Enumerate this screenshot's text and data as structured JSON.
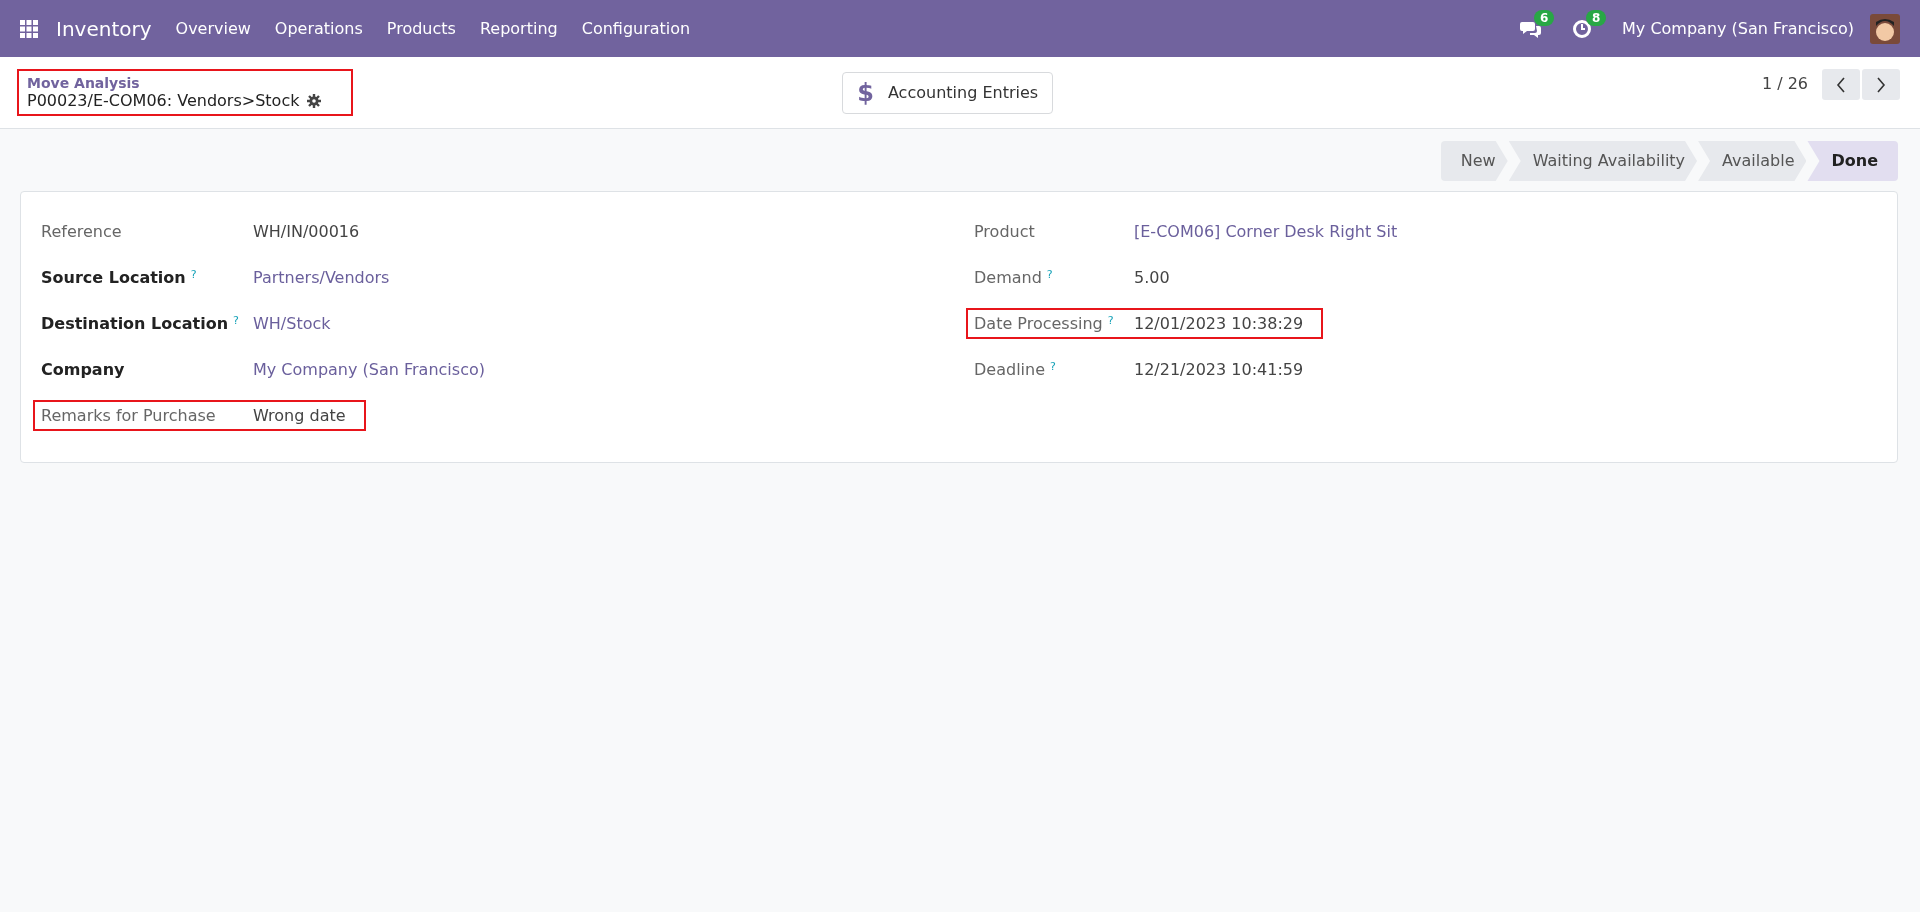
{
  "navbar": {
    "app_name": "Inventory",
    "menu": [
      "Overview",
      "Operations",
      "Products",
      "Reporting",
      "Configuration"
    ],
    "messages_count": "6",
    "activities_count": "8",
    "company": "My Company (San Francisco)"
  },
  "control_panel": {
    "breadcrumb": "Move Analysis",
    "record_title": "P00023/E-COM06: Vendors>Stock",
    "highlighted": true,
    "smart_button": {
      "icon": "$",
      "label": "Accounting Entries"
    },
    "pager": "1 / 26"
  },
  "status_bar": [
    {
      "label": "New",
      "selected": false
    },
    {
      "label": "Waiting Availability",
      "selected": false
    },
    {
      "label": "Available",
      "selected": false
    },
    {
      "label": "Done",
      "selected": true
    }
  ],
  "form": {
    "left": [
      {
        "label": "Reference",
        "required": false,
        "value": "WH/IN/00016",
        "kind": "text",
        "highlighted": false
      },
      {
        "label": "Source Location",
        "required": true,
        "help": "?",
        "value": "Partners/Vendors",
        "kind": "link",
        "highlighted": false
      },
      {
        "label": "Destination Location",
        "required": true,
        "help": "?",
        "value": "WH/Stock",
        "kind": "link",
        "highlighted": false
      },
      {
        "label": "Company",
        "required": true,
        "value": "My Company (San Francisco)",
        "kind": "link",
        "highlighted": false
      },
      {
        "label": "Remarks for Purchase",
        "required": false,
        "value": "Wrong date",
        "kind": "text",
        "highlighted": true
      }
    ],
    "right": [
      {
        "label": "Product",
        "required": false,
        "value": "[E-COM06] Corner Desk Right Sit",
        "kind": "link",
        "highlighted": false
      },
      {
        "label": "Demand",
        "required": false,
        "help": "?",
        "value": "5.00",
        "kind": "text",
        "highlighted": false
      },
      {
        "label": "Date Processing",
        "required": false,
        "help": "?",
        "value": "12/01/2023 10:38:29",
        "kind": "text",
        "highlighted": true
      },
      {
        "label": "Deadline",
        "required": false,
        "help": "?",
        "value": "12/21/2023 10:41:59",
        "kind": "text",
        "highlighted": false
      }
    ]
  }
}
